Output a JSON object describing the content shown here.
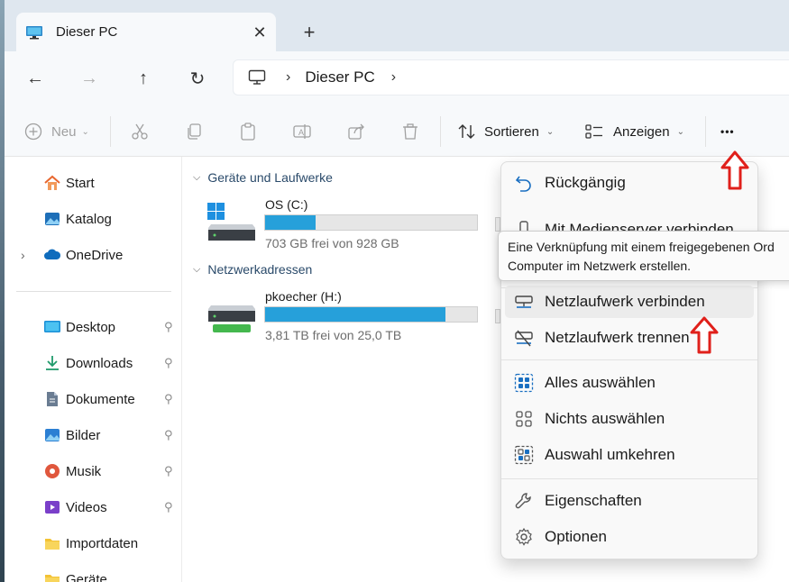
{
  "window": {
    "tab_title": "Dieser PC",
    "tab_close": "✕",
    "new_tab": "+"
  },
  "navigation": {
    "back_icon": "←",
    "forward_icon": "→",
    "up_icon": "↑",
    "refresh_icon": "↻",
    "breadcrumb": "Dieser PC",
    "chevron": "›"
  },
  "toolbar": {
    "new_label": "Neu",
    "sort_label": "Sortieren",
    "view_label": "Anzeigen",
    "more_label": "•••"
  },
  "sidebar": {
    "items": [
      {
        "label": "Start",
        "icon": "home-icon",
        "pinned": false
      },
      {
        "label": "Katalog",
        "icon": "gallery-icon",
        "pinned": false
      },
      {
        "label": "OneDrive",
        "icon": "cloud-icon",
        "pinned": false
      },
      {
        "label": "Desktop",
        "icon": "desktop-icon",
        "pinned": true
      },
      {
        "label": "Downloads",
        "icon": "download-icon",
        "pinned": true
      },
      {
        "label": "Dokumente",
        "icon": "document-icon",
        "pinned": true
      },
      {
        "label": "Bilder",
        "icon": "image-icon",
        "pinned": true
      },
      {
        "label": "Musik",
        "icon": "music-icon",
        "pinned": true
      },
      {
        "label": "Videos",
        "icon": "video-icon",
        "pinned": true
      },
      {
        "label": "Importdaten",
        "icon": "folder-icon",
        "pinned": false
      },
      {
        "label": "Geräte",
        "icon": "folder-icon",
        "pinned": false
      }
    ],
    "pin_glyph": "📌",
    "expand_glyph": "›"
  },
  "main": {
    "group_drives": "Geräte und Laufwerke",
    "group_network": "Netzwerkadressen",
    "drives": [
      {
        "name": "OS (C:)",
        "size_text": "703 GB frei von 928 GB",
        "used_fraction": 0.24
      },
      {
        "name": "pkoecher (H:)",
        "size_text": "3,81 TB frei von 25,0 TB",
        "used_fraction": 0.85
      }
    ]
  },
  "menu": {
    "items": [
      {
        "label": "Rückgängig",
        "icon": "undo-icon"
      },
      {
        "label": "Mit Medienserver verbinden",
        "icon": "media-server-icon"
      },
      {
        "label": "Netzlaufwerk verbinden",
        "icon": "map-network-drive-icon",
        "highlighted": true
      },
      {
        "label": "Netzlaufwerk trennen",
        "icon": "disconnect-network-drive-icon"
      },
      {
        "label": "Alles auswählen",
        "icon": "select-all-icon"
      },
      {
        "label": "Nichts auswählen",
        "icon": "select-none-icon"
      },
      {
        "label": "Auswahl umkehren",
        "icon": "invert-selection-icon"
      },
      {
        "label": "Eigenschaften",
        "icon": "wrench-icon"
      },
      {
        "label": "Optionen",
        "icon": "options-gear-icon"
      }
    ]
  },
  "tooltip": {
    "line1": "Eine Verknüpfung mit einem freigegebenen Ord",
    "line2": "Computer im Netzwerk erstellen."
  },
  "colors": {
    "accent": "#26a0da",
    "annotation_arrow": "#e0201b"
  }
}
